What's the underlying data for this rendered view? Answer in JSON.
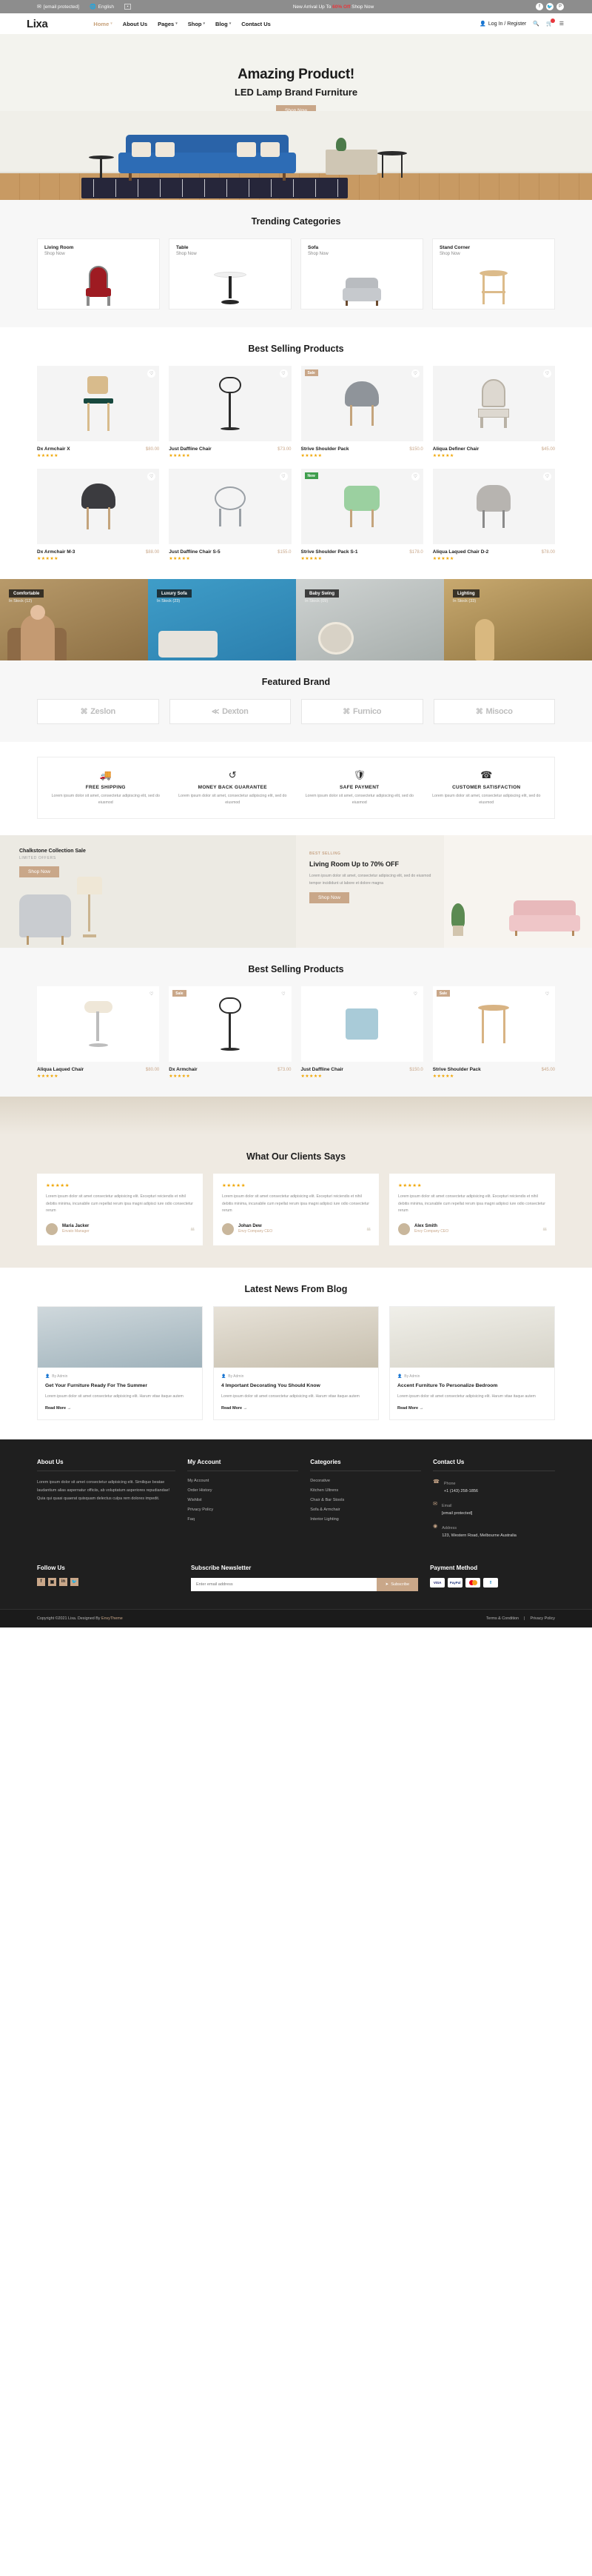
{
  "topbar": {
    "email": "[email protected]",
    "email_icon": "envelope-icon",
    "language": "English",
    "language_icon": "globe-icon",
    "flag": "▪",
    "promo_prefix": "New Arrival Up To ",
    "promo_highlight": "60% Off",
    "promo_suffix": " Shop Now",
    "socials": [
      {
        "name": "facebook-icon",
        "glyph": "f"
      },
      {
        "name": "twitter-icon",
        "glyph": "🐦"
      },
      {
        "name": "pinterest-icon",
        "glyph": "P"
      }
    ]
  },
  "nav": {
    "logo": "Lixa",
    "menu": [
      {
        "label": "Home",
        "caret": "▾",
        "active": true
      },
      {
        "label": "About Us",
        "caret": "",
        "active": false
      },
      {
        "label": "Pages",
        "caret": "▾",
        "active": false
      },
      {
        "label": "Shop",
        "caret": "▾",
        "active": false
      },
      {
        "label": "Blog",
        "caret": "▾",
        "active": false
      },
      {
        "label": "Contact Us",
        "caret": "",
        "active": false
      }
    ],
    "login": "Log In / Register",
    "search_icon": "search-icon",
    "cart_icon": "cart-icon",
    "menu_icon": "hamburger-icon"
  },
  "hero": {
    "title": "Amazing Product!",
    "subtitle": "LED Lamp Brand Furniture",
    "cta": "Shop Now"
  },
  "trending": {
    "title": "Trending Categories",
    "items": [
      {
        "name": "Living Room",
        "link": "Shop Now",
        "art": "f-redchair"
      },
      {
        "name": "Table",
        "link": "Shop Now",
        "art": "f-table"
      },
      {
        "name": "Sofa",
        "link": "Shop Now",
        "art": "f-sofa"
      },
      {
        "name": "Stand Corner",
        "link": "Shop Now",
        "art": "f-stool"
      }
    ]
  },
  "best_selling": {
    "title": "Best Selling Products",
    "products": [
      {
        "name": "Dx Armchair X",
        "price": "$80.00",
        "stars": "★★★★★",
        "badge": "",
        "badge_type": "",
        "art": "s-barstool"
      },
      {
        "name": "Just Daffline Chair",
        "price": "$73.00",
        "stars": "★★★★★",
        "badge": "",
        "badge_type": "",
        "art": "s-wirestool"
      },
      {
        "name": "Strive Shoulder Pack",
        "price": "$150.0",
        "stars": "★★★★★",
        "badge": "Sale",
        "badge_type": "sale",
        "art": "s-greychair"
      },
      {
        "name": "Aliqua Definer Chair",
        "price": "$45.00",
        "stars": "★★★★★",
        "badge": "",
        "badge_type": "",
        "art": "s-throne"
      },
      {
        "name": "Dx Armchair M-3",
        "price": "$88.00",
        "stars": "★★★★★",
        "badge": "",
        "badge_type": "",
        "art": "s-darkchair"
      },
      {
        "name": "Just Daffline Chair S-5",
        "price": "$155.0",
        "stars": "★★★★★",
        "badge": "",
        "badge_type": "",
        "art": "s-wirechair"
      },
      {
        "name": "Strive Shoulder Pack S-1",
        "price": "$178.0",
        "stars": "★★★★★",
        "badge": "New",
        "badge_type": "new",
        "art": "s-green"
      },
      {
        "name": "Aliqua Laqued Chair D-2",
        "price": "$78.00",
        "stars": "★★★★★",
        "badge": "",
        "badge_type": "",
        "art": "s-tufted"
      }
    ]
  },
  "promo_strip": [
    {
      "tag": "Comfortable",
      "sub": "In Stock (12)",
      "cls": "pc1",
      "fig": "fig-person"
    },
    {
      "tag": "Luxury Sofa",
      "sub": "In Stock (23)",
      "cls": "pc2",
      "fig": "fig-sofa"
    },
    {
      "tag": "Baby Swing",
      "sub": "In Stock (09)",
      "cls": "pc3",
      "fig": "fig-swing"
    },
    {
      "tag": "Lighting",
      "sub": "In Stock (33)",
      "cls": "pc4",
      "fig": "fig-lamp"
    }
  ],
  "brands": {
    "title": "Featured Brand",
    "items": [
      {
        "name": "Zeslon",
        "mark": "⌘"
      },
      {
        "name": "Dexton",
        "mark": "≪"
      },
      {
        "name": "Furnico",
        "mark": "⌘"
      },
      {
        "name": "Misoco",
        "mark": "⌘"
      }
    ]
  },
  "services": [
    {
      "icon": "truck-icon",
      "glyph": "🚚",
      "title": "FREE SHIPPING",
      "desc": "Lorem ipsum dolor sit amet, consectetur adipiscing elit, sed do eiusmod"
    },
    {
      "icon": "refresh-icon",
      "glyph": "↺",
      "title": "MONEY BACK GUARANTEE",
      "desc": "Lorem ipsum dolor sit amet, consectetur adipiscing elit, sed do eiusmod"
    },
    {
      "icon": "shield-icon",
      "glyph": "🛡",
      "title": "SAFE PAYMENT",
      "desc": "Lorem ipsum dolor sit amet, consectetur adipiscing elit, sed do eiusmod"
    },
    {
      "icon": "headset-icon",
      "glyph": "☎",
      "title": "CUSTOMER SATISFACTION",
      "desc": "Lorem ipsum dolor sit amet, consectetur adipiscing elit, sed do eiusmod"
    }
  ],
  "sale_left": {
    "title": "Chalkstone Collection Sale",
    "sub": "LIMITED OFFERS",
    "cta": "Shop Now"
  },
  "sale_right": {
    "kicker": "BEST SELLING",
    "title": "Living Room Up to 70% OFF",
    "desc": "Lorem ipsum dolor sit amet, consectetur adipiscing elit, sed do eiusmod tempor incididunt ut labore et dolore magna",
    "cta": "Shop Now"
  },
  "best_selling_2": {
    "title": "Best Selling Products",
    "products": [
      {
        "name": "Aliqua Laqued Chair",
        "price": "$80.00",
        "stars": "★★★★★",
        "badge": "",
        "badge_type": "",
        "art": "s-whitestool"
      },
      {
        "name": "Dx Armchair",
        "price": "$73.00",
        "stars": "★★★★★",
        "badge": "Sale",
        "badge_type": "sale",
        "art": "s-wirestool"
      },
      {
        "name": "Just Daffline Chair",
        "price": "$150.0",
        "stars": "★★★★★",
        "badge": "",
        "badge_type": "",
        "art": "s-pillow"
      },
      {
        "name": "Strive Shoulder Pack",
        "price": "$45.00",
        "stars": "★★★★★",
        "badge": "Sale",
        "badge_type": "sale",
        "art": "s-woodstool"
      }
    ]
  },
  "testimonials": {
    "title": "What Our Clients Says",
    "items": [
      {
        "stars": "★★★★★",
        "text": "Lorem ipsum dolor sit amet consectetur adipisicing elit. Excepturi reiciendis et nihil debitis minima, incunabile cum repellat rerum ipsa magni adipisci iure odio consectetur rerum",
        "name": "Maria Jacker",
        "role": "Envato Manager",
        "quote": "❝"
      },
      {
        "stars": "★★★★★",
        "text": "Lorem ipsum dolor sit amet consectetur adipisicing elit. Excepturi reiciendis et nihil debitis minima, incunabile cum repellat rerum ipsa magni adipisci iure odio consectetur rerum",
        "name": "Johan Dew",
        "role": "Envy Company CEO",
        "quote": "❝"
      },
      {
        "stars": "★★★★★",
        "text": "Lorem ipsum dolor sit amet consectetur adipisicing elit. Excepturi reiciendis et nihil debitis minima, incunabile cum repellat rerum ipsa magni adipisci iure odio consectetur rerum",
        "name": "Alex Smith",
        "role": "Envy Company CEO",
        "quote": "❝"
      }
    ]
  },
  "blog": {
    "title": "Latest News From Blog",
    "posts": [
      {
        "meta": "By Admin",
        "title": "Get Your Furniture Ready For The Summer",
        "desc": "Lorem ipsum dolor sit amet consectetur adipisicing elit. Harum vitae itaque autem",
        "more": "Read More →",
        "cls": "bi1"
      },
      {
        "meta": "By Admin",
        "title": "4 Important Decorating You Should Know",
        "desc": "Lorem ipsum dolor sit amet consectetur adipisicing elit. Harum vitae itaque autem",
        "more": "Read More →",
        "cls": "bi2"
      },
      {
        "meta": "By Admin",
        "title": "Accent Furniture To Personalize Bedroom",
        "desc": "Lorem ipsum dolor sit amet consectetur adipisicing elit. Harum vitae itaque autem",
        "more": "Read More →",
        "cls": "bi3"
      }
    ]
  },
  "footer": {
    "about": {
      "head": "About Us",
      "text": "Lorem ipsum dolor sit amet consectetur adipisicing elit. Similique beatae laudantium alias aspernatur officiis, ab voluptatum asperiores repudiandae! Quia qui quasi quaerat quisquam delectus culpa rem dolores impedit."
    },
    "account": {
      "head": "My Account",
      "links": [
        "My Account",
        "Order History",
        "Wishlist",
        "Privacy Policy",
        "Faq"
      ]
    },
    "categories": {
      "head": "Categories",
      "links": [
        "Decorative",
        "Kitchen Ultrens",
        "Chair & Bar Stools",
        "Sofa & Armchair",
        "Interior Lighting"
      ]
    },
    "contact": {
      "head": "Contact Us",
      "items": [
        {
          "icon": "phone-icon",
          "glyph": "☎",
          "label": "Phone",
          "value": "+1 (143) 258-1856"
        },
        {
          "icon": "envelope-icon",
          "glyph": "✉",
          "label": "Email",
          "value": "[email protected]"
        },
        {
          "icon": "location-icon",
          "glyph": "◉",
          "label": "Address",
          "value": "123, Western Road, Melbourne Australia"
        }
      ]
    },
    "follow": {
      "head": "Follow Us",
      "socials": [
        {
          "name": "facebook-icon",
          "glyph": "f"
        },
        {
          "name": "instagram-icon",
          "glyph": "▣"
        },
        {
          "name": "linkedin-icon",
          "glyph": "in"
        },
        {
          "name": "twitter-icon",
          "glyph": "🐦"
        }
      ]
    },
    "newsletter": {
      "head": "Subscribe Newsletter",
      "placeholder": "Enter email address",
      "button": "Subscribe"
    },
    "payment": {
      "head": "Payment Method",
      "methods": [
        "VISA",
        "PayPal",
        "Mastercard",
        "Maestro"
      ]
    },
    "bottom": {
      "copyright_prefix": "Copyright ©2021 Lixa. Designed By ",
      "brand": "EnvyTheme",
      "links": [
        "Terms & Condition",
        "Privacy Policy"
      ],
      "divider": "|"
    }
  }
}
